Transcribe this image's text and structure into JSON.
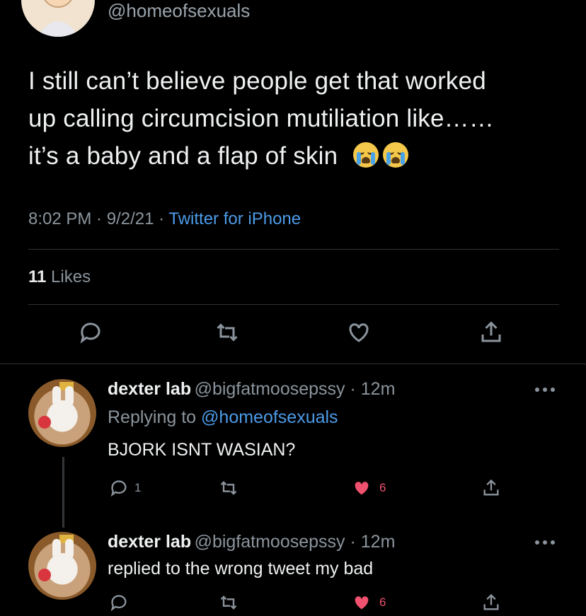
{
  "main_tweet": {
    "handle": "@homeofsexuals",
    "text_line1": "I still can’t believe people get that worked",
    "text_line2": "up calling circumcision mutiliation like……",
    "text_line3": "it’s a baby and a flap of skin",
    "emoji_name": "loudly-crying-face",
    "time": "8:02 PM",
    "date": "9/2/21",
    "source": "Twitter for iPhone",
    "likes_count": "11",
    "likes_label": "Likes"
  },
  "replies": [
    {
      "name": "dexter lab",
      "handle": "@bigfatmoosepssy",
      "time": "12m",
      "replying_prefix": "Replying to",
      "replying_to": "@homeofsexuals",
      "text": "BJORK ISNT WASIAN?",
      "reply_count": "1",
      "like_count": "6"
    },
    {
      "name": "dexter lab",
      "handle": "@bigfatmoosepssy",
      "time": "12m",
      "text": "replied to the wrong tweet my bad",
      "like_count": "6"
    }
  ],
  "separator": " · ",
  "colors": {
    "background": "#000000",
    "text": "#e7e9ea",
    "secondary": "#8b949c",
    "link": "#4c9be8",
    "like": "#f0516e"
  },
  "icons": [
    "reply-icon",
    "retweet-icon",
    "like-icon",
    "share-icon",
    "more-icon"
  ]
}
